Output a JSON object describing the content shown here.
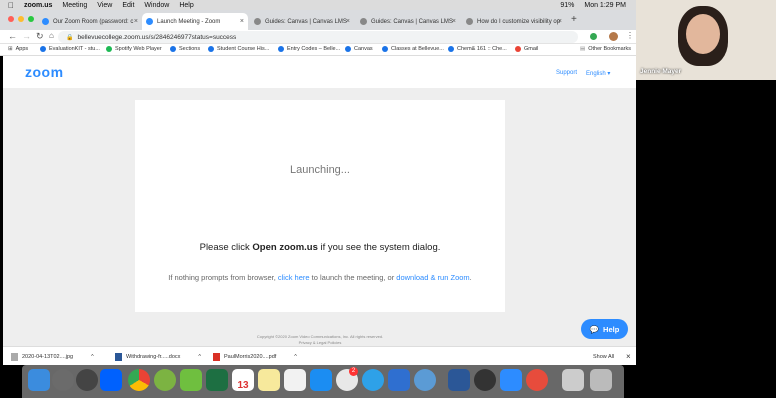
{
  "menubar": {
    "app": "zoom.us",
    "items": [
      "Meeting",
      "View",
      "Edit",
      "Window",
      "Help"
    ],
    "battery": "91%",
    "clock": "Mon 1:29 PM"
  },
  "tabs": [
    {
      "label": "Our Zoom Room (password: c",
      "active": false
    },
    {
      "label": "Launch Meeting - Zoom",
      "active": true
    },
    {
      "label": "Guides: Canvas | Canvas LMS",
      "active": false
    },
    {
      "label": "Guides: Canvas | Canvas LMS",
      "active": false
    },
    {
      "label": "How do I customize visibility op",
      "active": false
    }
  ],
  "url": "bellevuecollege.zoom.us/s/2846246977status=success",
  "bookmarks": [
    "Apps",
    "EvaluationKIT - stu...",
    "Spotify Web Player",
    "Sections",
    "Student Course His...",
    "Entry Codes – Belle...",
    "Canvas",
    "Classes at Bellevue...",
    "Chem& 161 :: Che...",
    "Gmail",
    "Other Bookmarks"
  ],
  "zoom": {
    "logo": "zoom",
    "support": "Support",
    "language": "English",
    "launching": "Launching...",
    "dialog_pre": "Please click ",
    "dialog_bold": "Open zoom.us",
    "dialog_post": " if you see the system dialog.",
    "prompt_pre": "If nothing prompts from browser, ",
    "prompt_link1": "click here",
    "prompt_mid": " to launch the meeting, or ",
    "prompt_link2": "download & run Zoom",
    "prompt_end": ".",
    "copyright": "Copyright ©2020 Zoom Video Communications, Inc. All rights reserved.",
    "privacy": "Privacy & Legal Policies",
    "help": "Help"
  },
  "downloads": {
    "files": [
      "2020-04-13T02....jpg",
      "Withdrawing-fr.....docx",
      "PaulMorris2020....pdf"
    ],
    "show_all": "Show All"
  },
  "video": {
    "name": "Jennie Mayer"
  },
  "calendar_day": "13",
  "badge": "2",
  "colors": {
    "zoom_blue": "#2d8cff",
    "link": "#2d8cff"
  }
}
